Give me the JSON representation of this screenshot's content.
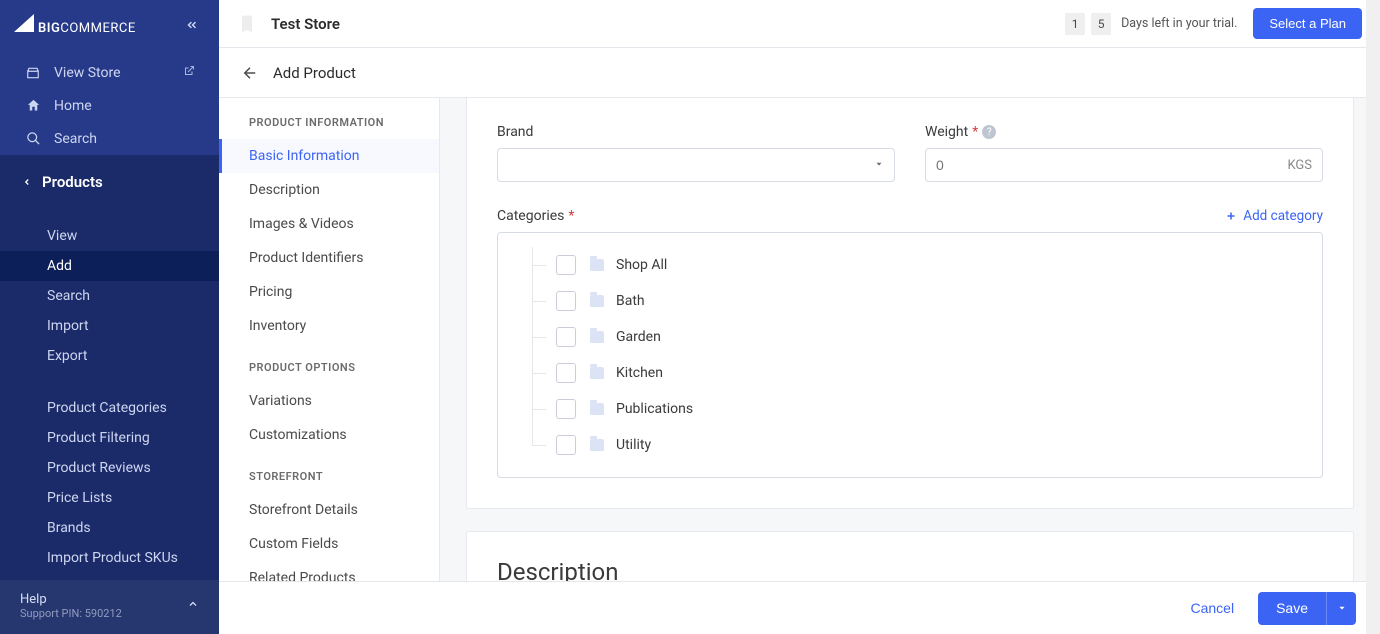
{
  "brand": {
    "name_big": "BIG",
    "name_rest": "COMMERCE"
  },
  "sidebar": {
    "top": [
      {
        "label": "View Store",
        "icon": "store-icon",
        "external": true
      },
      {
        "label": "Home",
        "icon": "home-icon",
        "external": false
      },
      {
        "label": "Search",
        "icon": "search-icon",
        "external": false
      }
    ],
    "section_label": "Products",
    "sub": [
      {
        "label": "View",
        "active": false
      },
      {
        "label": "Add",
        "active": true
      },
      {
        "label": "Search",
        "active": false
      },
      {
        "label": "Import",
        "active": false
      },
      {
        "label": "Export",
        "active": false
      }
    ],
    "sub2": [
      {
        "label": "Product Categories"
      },
      {
        "label": "Product Filtering"
      },
      {
        "label": "Product Reviews"
      },
      {
        "label": "Price Lists"
      },
      {
        "label": "Brands"
      },
      {
        "label": "Import Product SKUs"
      }
    ]
  },
  "help": {
    "title": "Help",
    "pin": "Support PIN: 590212"
  },
  "header": {
    "store_name": "Test Store",
    "trial_digits": [
      "1",
      "5"
    ],
    "trial_label": "Days left in your trial.",
    "select_plan": "Select a Plan"
  },
  "page": {
    "title": "Add Product"
  },
  "section_nav": {
    "groups": [
      {
        "label": "PRODUCT INFORMATION",
        "items": [
          {
            "label": "Basic Information",
            "active": true
          },
          {
            "label": "Description"
          },
          {
            "label": "Images & Videos"
          },
          {
            "label": "Product Identifiers"
          },
          {
            "label": "Pricing"
          },
          {
            "label": "Inventory"
          }
        ]
      },
      {
        "label": "PRODUCT OPTIONS",
        "items": [
          {
            "label": "Variations"
          },
          {
            "label": "Customizations"
          }
        ]
      },
      {
        "label": "STOREFRONT",
        "items": [
          {
            "label": "Storefront Details"
          },
          {
            "label": "Custom Fields"
          },
          {
            "label": "Related Products"
          }
        ]
      }
    ]
  },
  "form": {
    "brand_label": "Brand",
    "weight_label": "Weight",
    "weight_placeholder": "0",
    "weight_unit": "KGS",
    "categories_label": "Categories",
    "add_category": "Add category",
    "categories": [
      "Shop All",
      "Bath",
      "Garden",
      "Kitchen",
      "Publications",
      "Utility"
    ],
    "description_heading": "Description"
  },
  "footer": {
    "cancel": "Cancel",
    "save": "Save"
  }
}
